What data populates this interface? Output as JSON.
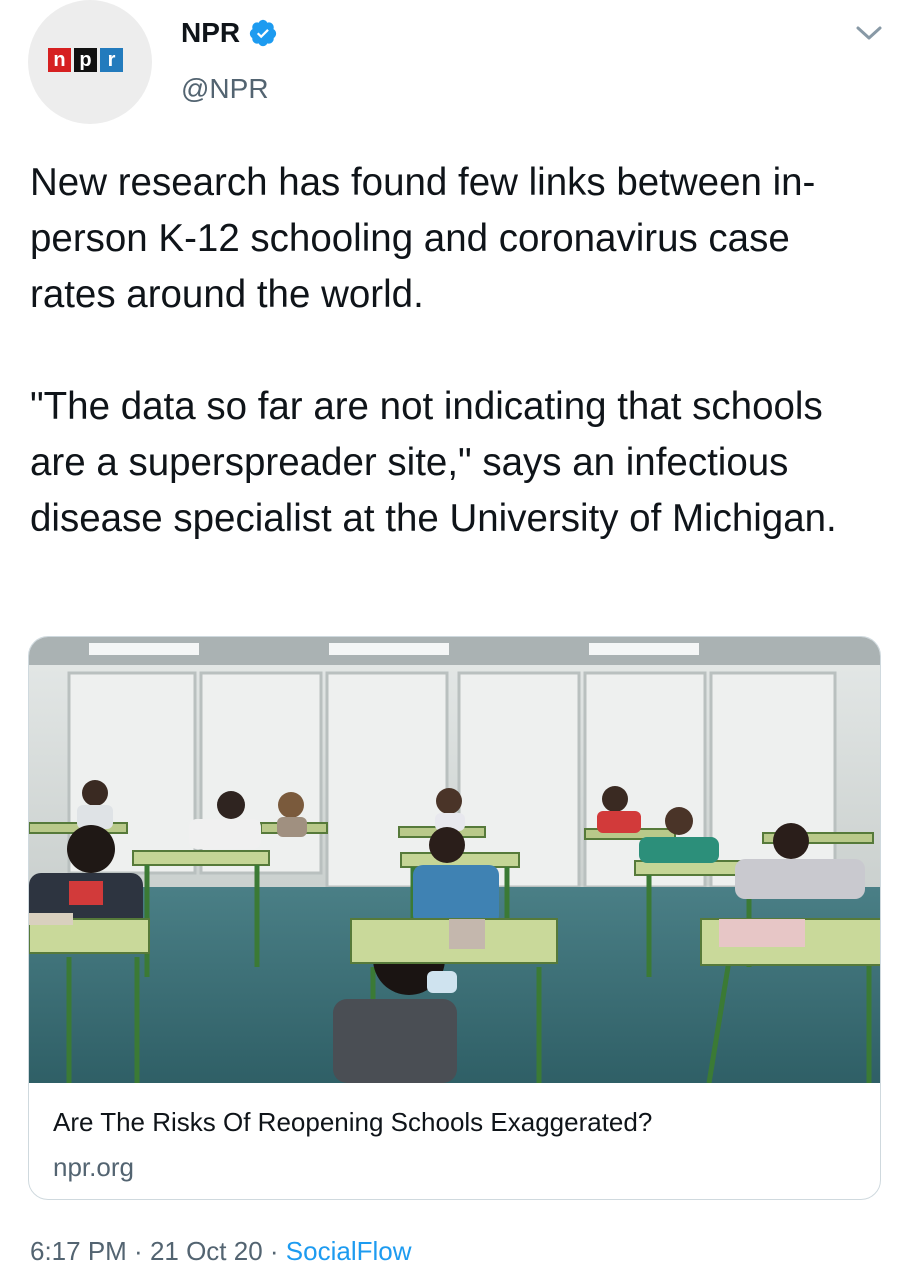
{
  "author": {
    "display_name": "NPR",
    "handle": "@NPR",
    "avatar_logo_letters": [
      "n",
      "p",
      "r"
    ],
    "verified": true,
    "verified_color": "#1d9bf0"
  },
  "tweet": {
    "paragraphs": [
      "New research has found few links between in-person K-12 schooling and coronavirus case rates around the world.",
      "\"The data so far are not indicating that schools are a superspreader site,\" says an infectious disease specialist at the University of Michigan."
    ]
  },
  "card": {
    "image_icon": "classroom-photo",
    "title": "Are The Risks Of Reopening Schools Exaggerated?",
    "domain": "npr.org"
  },
  "meta": {
    "time": "6:17 PM",
    "separator": " · ",
    "date": "21 Oct 20",
    "source": "SocialFlow"
  },
  "colors": {
    "text": "#0f1419",
    "secondary": "#536471",
    "link": "#1d9bf0",
    "npr_red": "#d62021",
    "npr_black": "#111111",
    "npr_blue": "#237bbd"
  },
  "icons": {
    "menu": "chevron-down-icon",
    "badge": "verified-badge-icon"
  }
}
